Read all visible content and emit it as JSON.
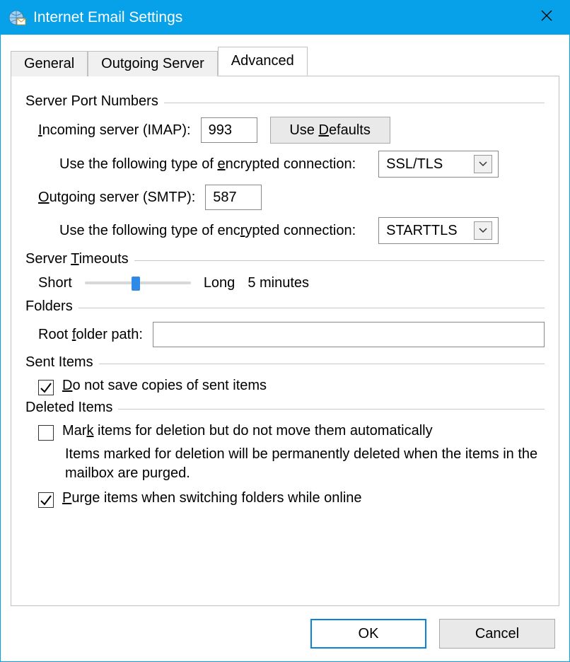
{
  "window": {
    "title": "Internet Email Settings",
    "icon_name": "globe-mail-icon"
  },
  "tabs": {
    "general": "General",
    "outgoing": "Outgoing Server",
    "advanced": "Advanced",
    "active": "advanced"
  },
  "sections": {
    "ports_title": "Server Port Numbers",
    "timeouts_title": "Server Timeouts",
    "folders_title": "Folders",
    "sent_title": "Sent Items",
    "deleted_title": "Deleted Items"
  },
  "ports": {
    "incoming_label_pre": "I",
    "incoming_label_post": "ncoming server (IMAP):",
    "incoming_value": "993",
    "use_defaults_pre": "Use ",
    "use_defaults_u": "D",
    "use_defaults_post": "efaults",
    "enc_label_pre": "Use the following type of ",
    "enc_label_u": "e",
    "enc_label_post": "ncrypted connection:",
    "incoming_enc_value": "SSL/TLS",
    "outgoing_label_u": "O",
    "outgoing_label_post": "utgoing server (SMTP):",
    "outgoing_value": "587",
    "enc2_label_pre": "Use the following type of enc",
    "enc2_label_u": "r",
    "enc2_label_post": "ypted connection:",
    "outgoing_enc_value": "STARTTLS"
  },
  "timeouts": {
    "short_label": "Short",
    "long_label": "Long",
    "value_label": "5 minutes",
    "header_u": "T",
    "header_pre": "Server ",
    "header_post": "imeouts"
  },
  "folders": {
    "root_label_pre": "Root ",
    "root_label_u": "f",
    "root_label_post": "older path:",
    "root_value": ""
  },
  "sent": {
    "cb_checked": true,
    "cb_label_u": "D",
    "cb_label_post": "o not save copies of sent items"
  },
  "deleted": {
    "mark_checked": false,
    "mark_pre": "Mar",
    "mark_u": "k",
    "mark_post": " items for deletion but do not move them automatically",
    "note": "Items marked for deletion will be permanently deleted when the items in the mailbox are purged.",
    "purge_checked": true,
    "purge_u": "P",
    "purge_post": "urge items when switching folders while online"
  },
  "footer": {
    "ok": "OK",
    "cancel": "Cancel"
  }
}
